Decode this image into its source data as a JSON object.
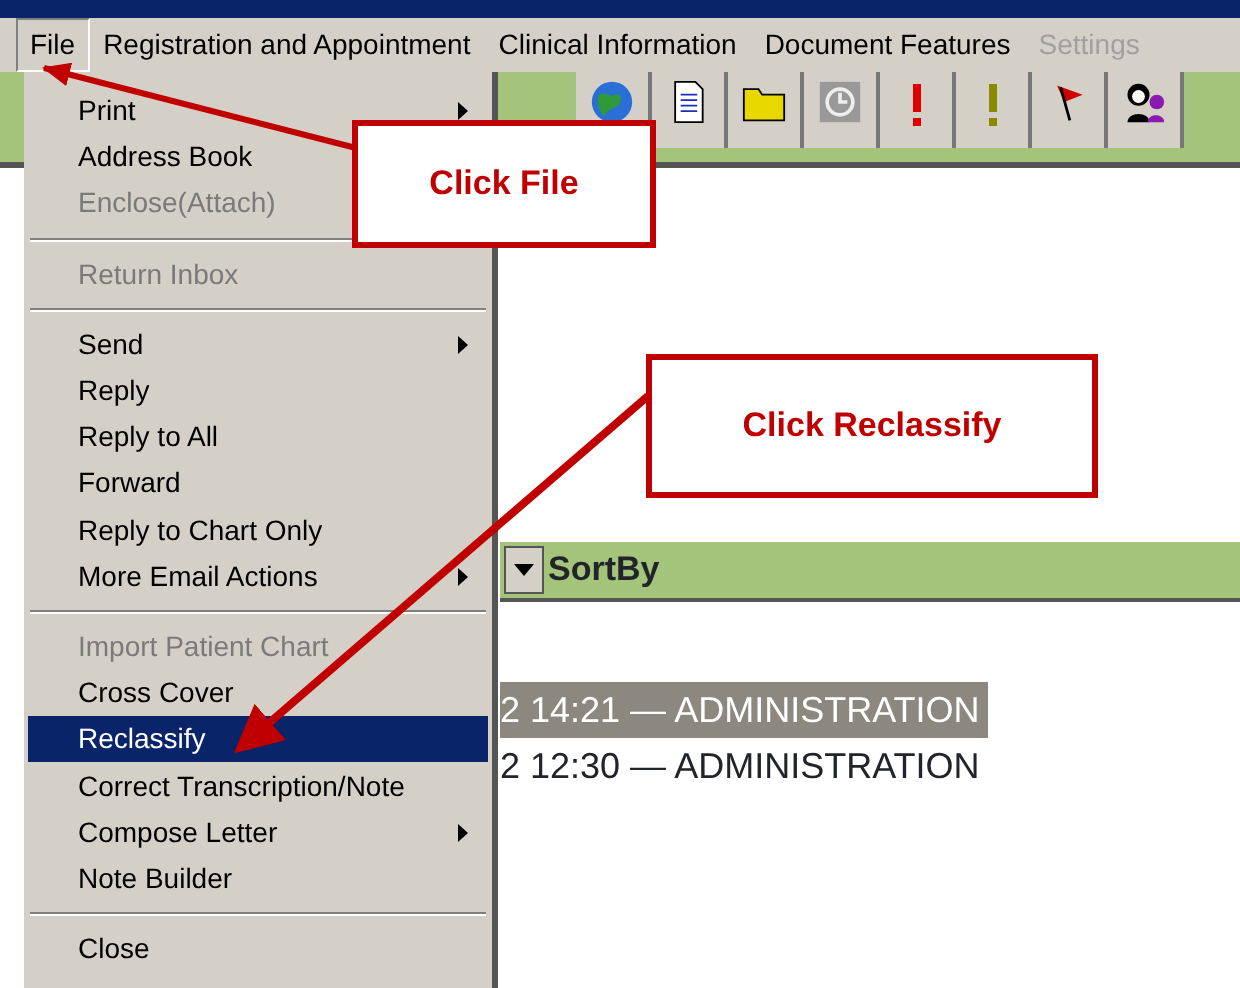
{
  "menu_bar": [
    {
      "label": "File",
      "selected": true,
      "disabled": false
    },
    {
      "label": "Registration and Appointment",
      "selected": false,
      "disabled": false
    },
    {
      "label": "Clinical Information",
      "selected": false,
      "disabled": false
    },
    {
      "label": "Document Features",
      "selected": false,
      "disabled": false
    },
    {
      "label": "Settings",
      "selected": false,
      "disabled": true
    }
  ],
  "toolbar": {
    "buttons": [
      {
        "kind": "globe"
      },
      {
        "kind": "document"
      },
      {
        "kind": "folder"
      },
      {
        "kind": "clock"
      },
      {
        "kind": "alert-red"
      },
      {
        "kind": "alert-olive"
      },
      {
        "kind": "flag"
      },
      {
        "kind": "people"
      }
    ]
  },
  "sort_bar": {
    "label": "SortBy"
  },
  "rows": [
    {
      "text": "2 14:21 — ADMINISTRATION",
      "selected": true
    },
    {
      "text": "2 12:30 — ADMINISTRATION",
      "selected": false
    }
  ],
  "file_menu": [
    {
      "kind": "item",
      "label": "Print",
      "disabled": false,
      "submenu": true,
      "selected": false
    },
    {
      "kind": "item",
      "label": "Address Book",
      "disabled": false,
      "selected": false
    },
    {
      "kind": "item",
      "label": "Enclose(Attach)",
      "disabled": true,
      "selected": false
    },
    {
      "kind": "separator"
    },
    {
      "kind": "item",
      "label": "Return Inbox",
      "disabled": true,
      "submenu": false,
      "selected": false
    },
    {
      "kind": "separator"
    },
    {
      "kind": "item",
      "label": "Send",
      "disabled": false,
      "submenu": true,
      "selected": false
    },
    {
      "kind": "item",
      "label": "Reply",
      "disabled": false,
      "submenu": false,
      "selected": false
    },
    {
      "kind": "item",
      "label": "Reply to All",
      "disabled": false,
      "submenu": false,
      "selected": false
    },
    {
      "kind": "item",
      "label": "Forward",
      "disabled": false,
      "submenu": false,
      "selected": false
    },
    {
      "kind": "item",
      "label": "Reply to Chart Only",
      "disabled": false,
      "submenu": false,
      "selected": false
    },
    {
      "kind": "item",
      "label": "More Email Actions",
      "disabled": false,
      "submenu": true,
      "selected": false
    },
    {
      "kind": "separator"
    },
    {
      "kind": "item",
      "label": "Import Patient Chart",
      "disabled": true,
      "submenu": false,
      "selected": false
    },
    {
      "kind": "item",
      "label": "Cross Cover",
      "disabled": false,
      "submenu": false,
      "selected": false
    },
    {
      "kind": "item",
      "label": "Reclassify",
      "disabled": false,
      "submenu": false,
      "selected": true
    },
    {
      "kind": "item",
      "label": "Correct Transcription/Note",
      "disabled": false,
      "submenu": false,
      "selected": false
    },
    {
      "kind": "item",
      "label": "Compose Letter",
      "disabled": false,
      "submenu": true,
      "selected": false
    },
    {
      "kind": "item",
      "label": "Note Builder",
      "disabled": false,
      "submenu": false,
      "selected": false
    },
    {
      "kind": "separator"
    },
    {
      "kind": "item",
      "label": "Close",
      "disabled": false,
      "submenu": false,
      "selected": false
    }
  ],
  "callouts": [
    {
      "text": "Click File"
    },
    {
      "text": "Click Reclassify"
    }
  ]
}
